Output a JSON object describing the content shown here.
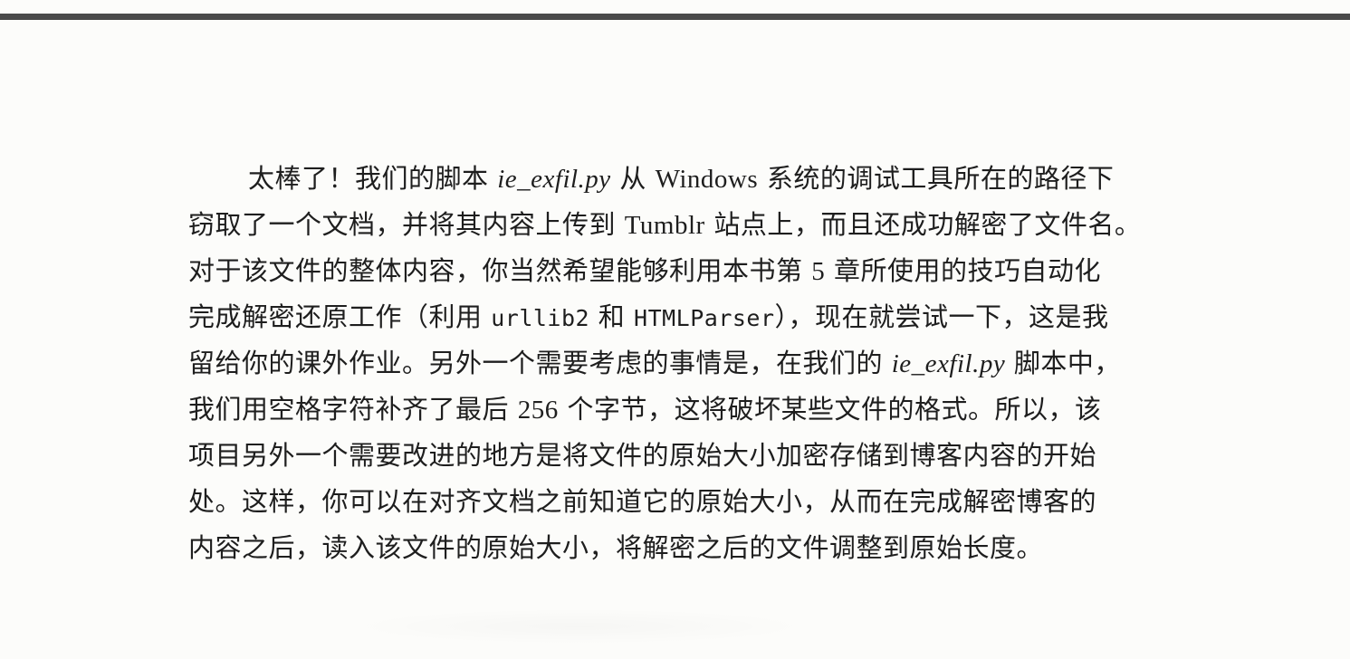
{
  "text": {
    "l1": {
      "a": "太棒了！我们的脚本 ",
      "b": "ie_exfil.py",
      "c": " 从 ",
      "d": "Windows",
      "e": " 系统的调试工具所在的路径下"
    },
    "l2": {
      "a": "窃取了一个文档，并将其内容上传到 ",
      "b": "Tumblr",
      "c": " 站点上，而且还成功解密了文件名。"
    },
    "l3": {
      "a": "对于该文件的整体内容，你当然希望能够利用本书第 ",
      "b": "5",
      "c": " 章所使用的技巧自动化"
    },
    "l4": {
      "a": "完成解密还原工作（利用 ",
      "b": "urllib2",
      "c": " 和 ",
      "d": "HTMLParser",
      "e": "），现在就尝试一下，这是我"
    },
    "l5": {
      "a": "留给你的课外作业。另外一个需要考虑的事情是，在我们的 ",
      "b": "ie_exfil.py",
      "c": " 脚本中，"
    },
    "l6": {
      "a": "我们用空格字符补齐了最后 ",
      "b": "256",
      "c": " 个字节，这将破坏某些文件的格式。所以，该"
    },
    "l7": "项目另外一个需要改进的地方是将文件的原始大小加密存储到博客内容的开始",
    "l8": "处。这样，你可以在对齐文档之前知道它的原始大小，从而在完成解密博客的",
    "l9": "内容之后，读入该文件的原始大小，将解密之后的文件调整到原始长度。"
  }
}
